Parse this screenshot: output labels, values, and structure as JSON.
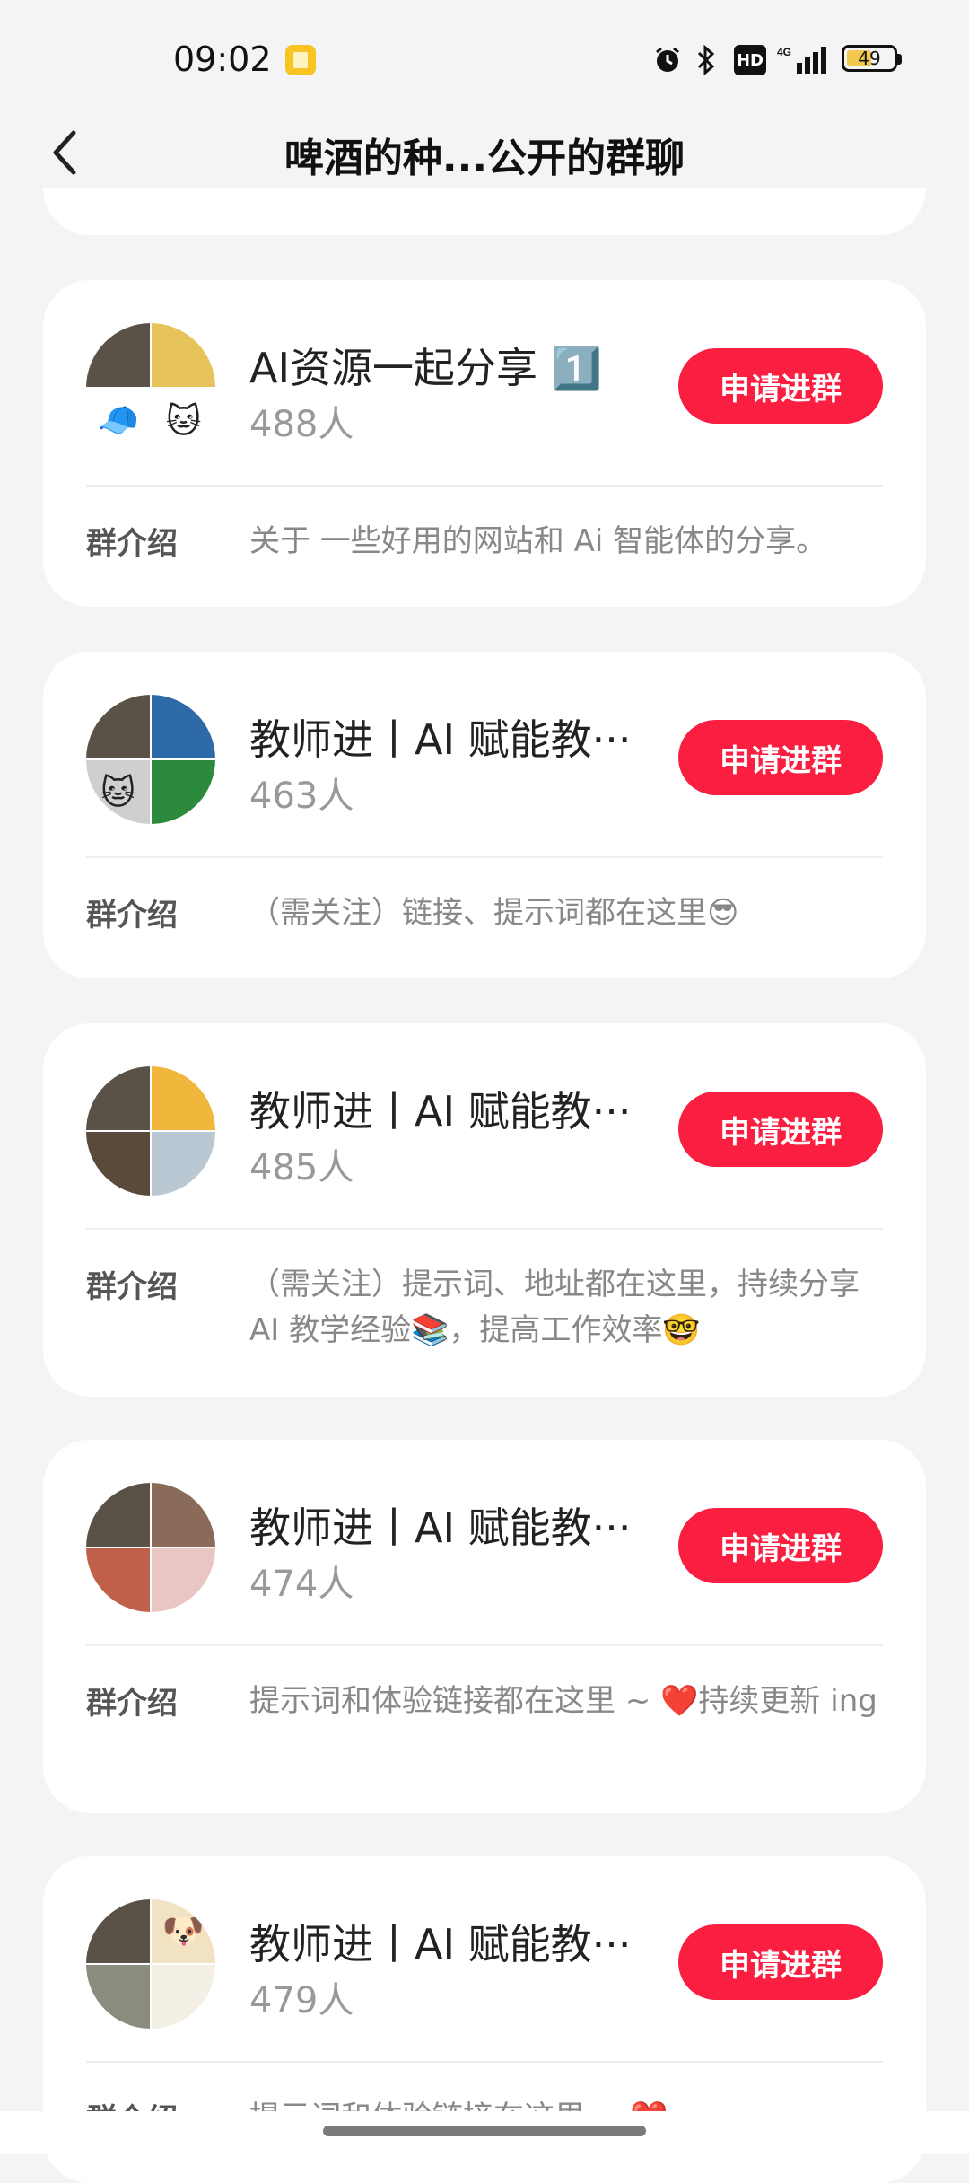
{
  "status_bar": {
    "time": "09:02",
    "battery": "49",
    "network": "4G",
    "hd": "HD"
  },
  "header": {
    "title": "啤酒的种...公开的群聊"
  },
  "join_label": "申请进群",
  "intro_label": "群介绍",
  "groups": [
    {
      "name": "AI资源一起分享 1️⃣",
      "count": "488人",
      "intro": "关于 一些好用的网站和 Ai 智能体的分享。",
      "avatar_colors": [
        "#5b5247",
        "#e6c35a",
        "#ffffff",
        "#ffffff"
      ],
      "avatar_emoji": [
        "",
        "",
        "🧢",
        "🐱"
      ]
    },
    {
      "name": "教师进丨AI 赋能教···",
      "count": "463人",
      "intro": "（需关注）链接、提示词都在这里😎",
      "avatar_colors": [
        "#5b5247",
        "#2f6aa8",
        "#cfcfcf",
        "#2c8a3d"
      ],
      "avatar_emoji": [
        "",
        "",
        "🐱",
        ""
      ]
    },
    {
      "name": "教师进丨AI 赋能教···",
      "count": "485人",
      "intro": "（需关注）提示词、地址都在这里，持续分享 AI 教学经验📚，提高工作效率🤓",
      "avatar_colors": [
        "#5b5247",
        "#f1b73c",
        "#5a4a3a",
        "#b9c8d3"
      ],
      "avatar_emoji": [
        "",
        "",
        "",
        ""
      ]
    },
    {
      "name": "教师进丨AI 赋能教···",
      "count": "474人",
      "intro": "提示词和体验链接都在这里 ~ ❤️持续更新 ing",
      "avatar_colors": [
        "#5b5247",
        "#8a6b5a",
        "#c0604a",
        "#e9c6c3"
      ],
      "avatar_emoji": [
        "",
        "",
        "",
        ""
      ]
    },
    {
      "name": "教师进丨AI 赋能教···",
      "count": "479人",
      "intro": "提示词和体验链接在这里 ~ ❤️",
      "avatar_colors": [
        "#5b5247",
        "#f1e3c2",
        "#8c8c7e",
        "#f3efe5"
      ],
      "avatar_emoji": [
        "",
        "🐶",
        "",
        ""
      ]
    }
  ]
}
